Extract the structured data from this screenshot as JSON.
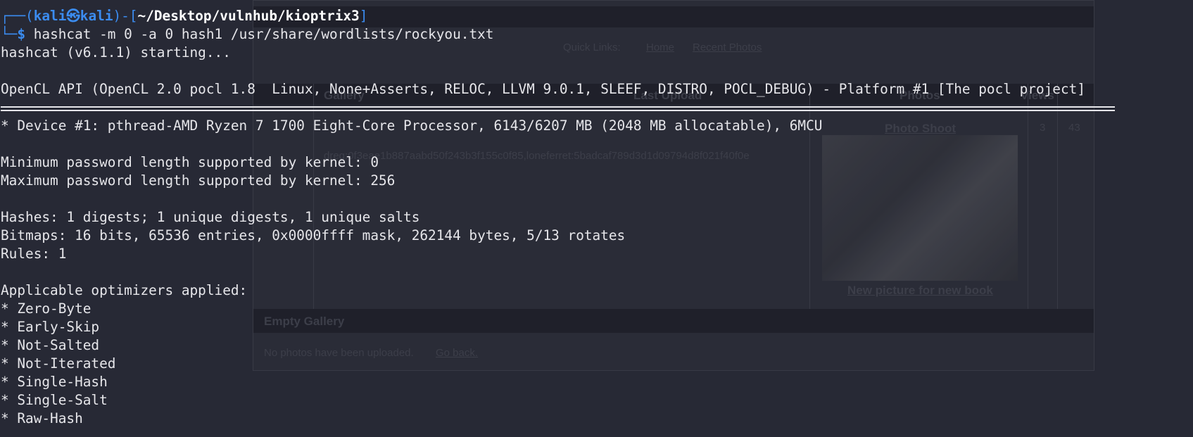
{
  "background_page": {
    "quick_links_label": "Quick Links:",
    "links": [
      "Home",
      "Recent Photos"
    ],
    "table_headers": [
      "Gallery",
      "Last Upload",
      "Photos",
      "Views"
    ],
    "photo_shoot": "Photo Shoot",
    "photo_count": "3",
    "view_count": "43",
    "hash_string": "dreg:0f3eae1b887aabd50f243b3f155c0f85,loneferret:5badcaf789d3d1d09794d8f021f40f0e",
    "caption": "New picture for new book",
    "empty_gallery_title": "Empty Gallery",
    "empty_text": "No photos have been uploaded.",
    "go_back": "Go back."
  },
  "terminal": {
    "prompt": {
      "corner_top": "┌──(",
      "user": "kali",
      "at": "㉿",
      "host": "kali",
      "mid": ")-[",
      "path": "~/Desktop/vulnhub/kioptrix3",
      "close": "]",
      "corner_bottom": "└─",
      "dollar": "$",
      "command": " hashcat -m 0 -a 0 hash1 /usr/share/wordlists/rockyou.txt"
    },
    "lines": [
      "hashcat (v6.1.1) starting...",
      "",
      "OpenCL API (OpenCL 2.0 pocl 1.8  Linux, None+Asserts, RELOC, LLVM 9.0.1, SLEEF, DISTRO, POCL_DEBUG) - Platform #1 [The pocl project]",
      "* Device #1: pthread-AMD Ryzen 7 1700 Eight-Core Processor, 6143/6207 MB (2048 MB allocatable), 6MCU",
      "",
      "Minimum password length supported by kernel: 0",
      "Maximum password length supported by kernel: 256",
      "",
      "Hashes: 1 digests; 1 unique digests, 1 unique salts",
      "Bitmaps: 16 bits, 65536 entries, 0x0000ffff mask, 262144 bytes, 5/13 rotates",
      "Rules: 1",
      "",
      "Applicable optimizers applied:",
      "* Zero-Byte",
      "* Early-Skip",
      "* Not-Salted",
      "* Not-Iterated",
      "* Single-Hash",
      "* Single-Salt",
      "* Raw-Hash"
    ]
  }
}
